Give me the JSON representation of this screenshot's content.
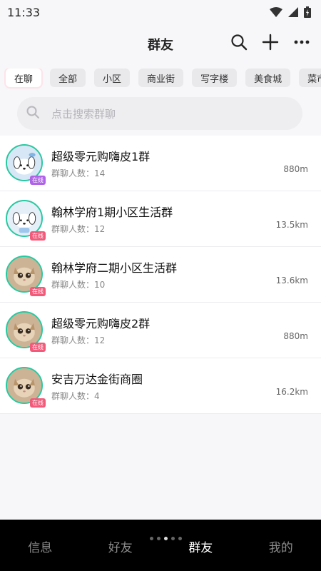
{
  "status": {
    "time": "11:33"
  },
  "header": {
    "title": "群友"
  },
  "tabs": [
    {
      "label": "在聊",
      "active": true
    },
    {
      "label": "全部"
    },
    {
      "label": "小区"
    },
    {
      "label": "商业街"
    },
    {
      "label": "写字楼"
    },
    {
      "label": "美食城"
    },
    {
      "label": "菜市场"
    }
  ],
  "search": {
    "placeholder": "点击搜索群聊"
  },
  "groups": [
    {
      "name": "超级零元购嗨皮1群",
      "members": "群聊人数：14",
      "distance": "880m",
      "badge": "在线",
      "avatar": "dog-icon"
    },
    {
      "name": "翰林学府1期小区生活群",
      "members": "群聊人数：12",
      "distance": "13.5km",
      "badge": "在线",
      "avatar": "dog-icon"
    },
    {
      "name": "翰林学府二期小区生活群",
      "members": "群聊人数：10",
      "distance": "13.6km",
      "badge": "在线",
      "avatar": "cat-icon"
    },
    {
      "name": "超级零元购嗨皮2群",
      "members": "群聊人数：12",
      "distance": "880m",
      "badge": "在线",
      "avatar": "cat-icon"
    },
    {
      "name": "安吉万达金街商圈",
      "members": "群聊人数：4",
      "distance": "16.2km",
      "badge": "在线",
      "avatar": "cat-icon"
    }
  ],
  "nav": [
    {
      "label": "信息"
    },
    {
      "label": "好友"
    },
    {
      "label": "群友",
      "active": true
    },
    {
      "label": "我的"
    }
  ],
  "colors": {
    "accent": "#27c9a0",
    "badge": "#f25a7a",
    "nav_bg": "#000000"
  }
}
